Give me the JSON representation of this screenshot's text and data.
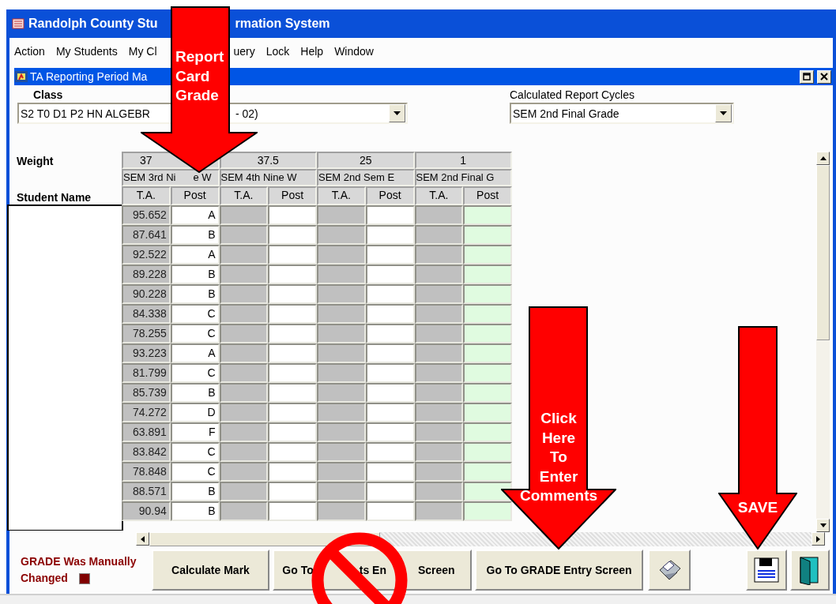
{
  "app_window": {
    "title_parts": [
      "Randolph County Stu",
      "rmation System"
    ]
  },
  "menu": [
    {
      "label": "Action"
    },
    {
      "label": "My Students"
    },
    {
      "label": "My Cl"
    },
    {
      "label": "uery"
    },
    {
      "label": "Lock"
    },
    {
      "label": "Help"
    },
    {
      "label": "Window"
    }
  ],
  "child_window": {
    "title": "TA Reporting Period Ma"
  },
  "class_field": {
    "label": "Class",
    "value_parts": [
      "S2 T0 D1 P2 HN ALGEBR",
      "- 02)"
    ]
  },
  "report_cycles": {
    "label": "Calculated Report Cycles",
    "value": "SEM 2nd Final Grade"
  },
  "grid": {
    "weight_label": "Weight",
    "student_label": "Student Name",
    "groups": [
      {
        "kind": "term",
        "weight": "37",
        "name_parts": [
          "SEM 3rd Ni",
          "e W"
        ],
        "columns": [
          "T.A.",
          "Post"
        ]
      },
      {
        "kind": "term",
        "weight": "37.5",
        "name_parts": [
          "SEM 4th Nine W"
        ],
        "columns": [
          "T.A.",
          "Post"
        ]
      },
      {
        "kind": "term",
        "weight": "25",
        "name_parts": [
          "SEM 2nd Sem E"
        ],
        "columns": [
          "T.A.",
          "Post"
        ]
      },
      {
        "kind": "final",
        "weight": "1",
        "name_parts": [
          "SEM 2nd Final G"
        ],
        "columns": [
          "T.A.",
          "Post"
        ]
      }
    ],
    "rows": [
      {
        "ta": "95.652",
        "post": "A"
      },
      {
        "ta": "87.641",
        "post": "B"
      },
      {
        "ta": "92.522",
        "post": "A"
      },
      {
        "ta": "89.228",
        "post": "B"
      },
      {
        "ta": "90.228",
        "post": "B"
      },
      {
        "ta": "84.338",
        "post": "C"
      },
      {
        "ta": "78.255",
        "post": "C"
      },
      {
        "ta": "93.223",
        "post": "A"
      },
      {
        "ta": "81.799",
        "post": "C"
      },
      {
        "ta": "85.739",
        "post": "B"
      },
      {
        "ta": "74.272",
        "post": "D"
      },
      {
        "ta": "63.891",
        "post": "F"
      },
      {
        "ta": "83.842",
        "post": "C"
      },
      {
        "ta": "78.848",
        "post": "C"
      },
      {
        "ta": "88.571",
        "post": "B"
      },
      {
        "ta": "90.94",
        "post": "B"
      }
    ]
  },
  "manual_change": {
    "label_lines": [
      "GRADE Was Manually",
      "Changed"
    ],
    "checked": true
  },
  "buttons": [
    {
      "kind": "text",
      "label_parts": [
        "Calculate Mark"
      ]
    },
    {
      "kind": "text",
      "label_parts": [
        "Go To",
        "ts En",
        "Screen"
      ]
    },
    {
      "kind": "text",
      "label_parts": [
        "Go To GRADE Entry Screen"
      ]
    },
    {
      "kind": "printer"
    },
    {
      "kind": "save"
    },
    {
      "kind": "exit"
    }
  ],
  "annotations": [
    {
      "kind": "arrow",
      "lines": [
        "Report",
        "Card",
        "Grade"
      ]
    },
    {
      "kind": "arrow",
      "lines": [
        "Click",
        "Here",
        "To",
        "Enter",
        "Comments"
      ]
    },
    {
      "kind": "arrow",
      "lines": [
        "SAVE"
      ]
    },
    {
      "kind": "no-sign"
    }
  ]
}
